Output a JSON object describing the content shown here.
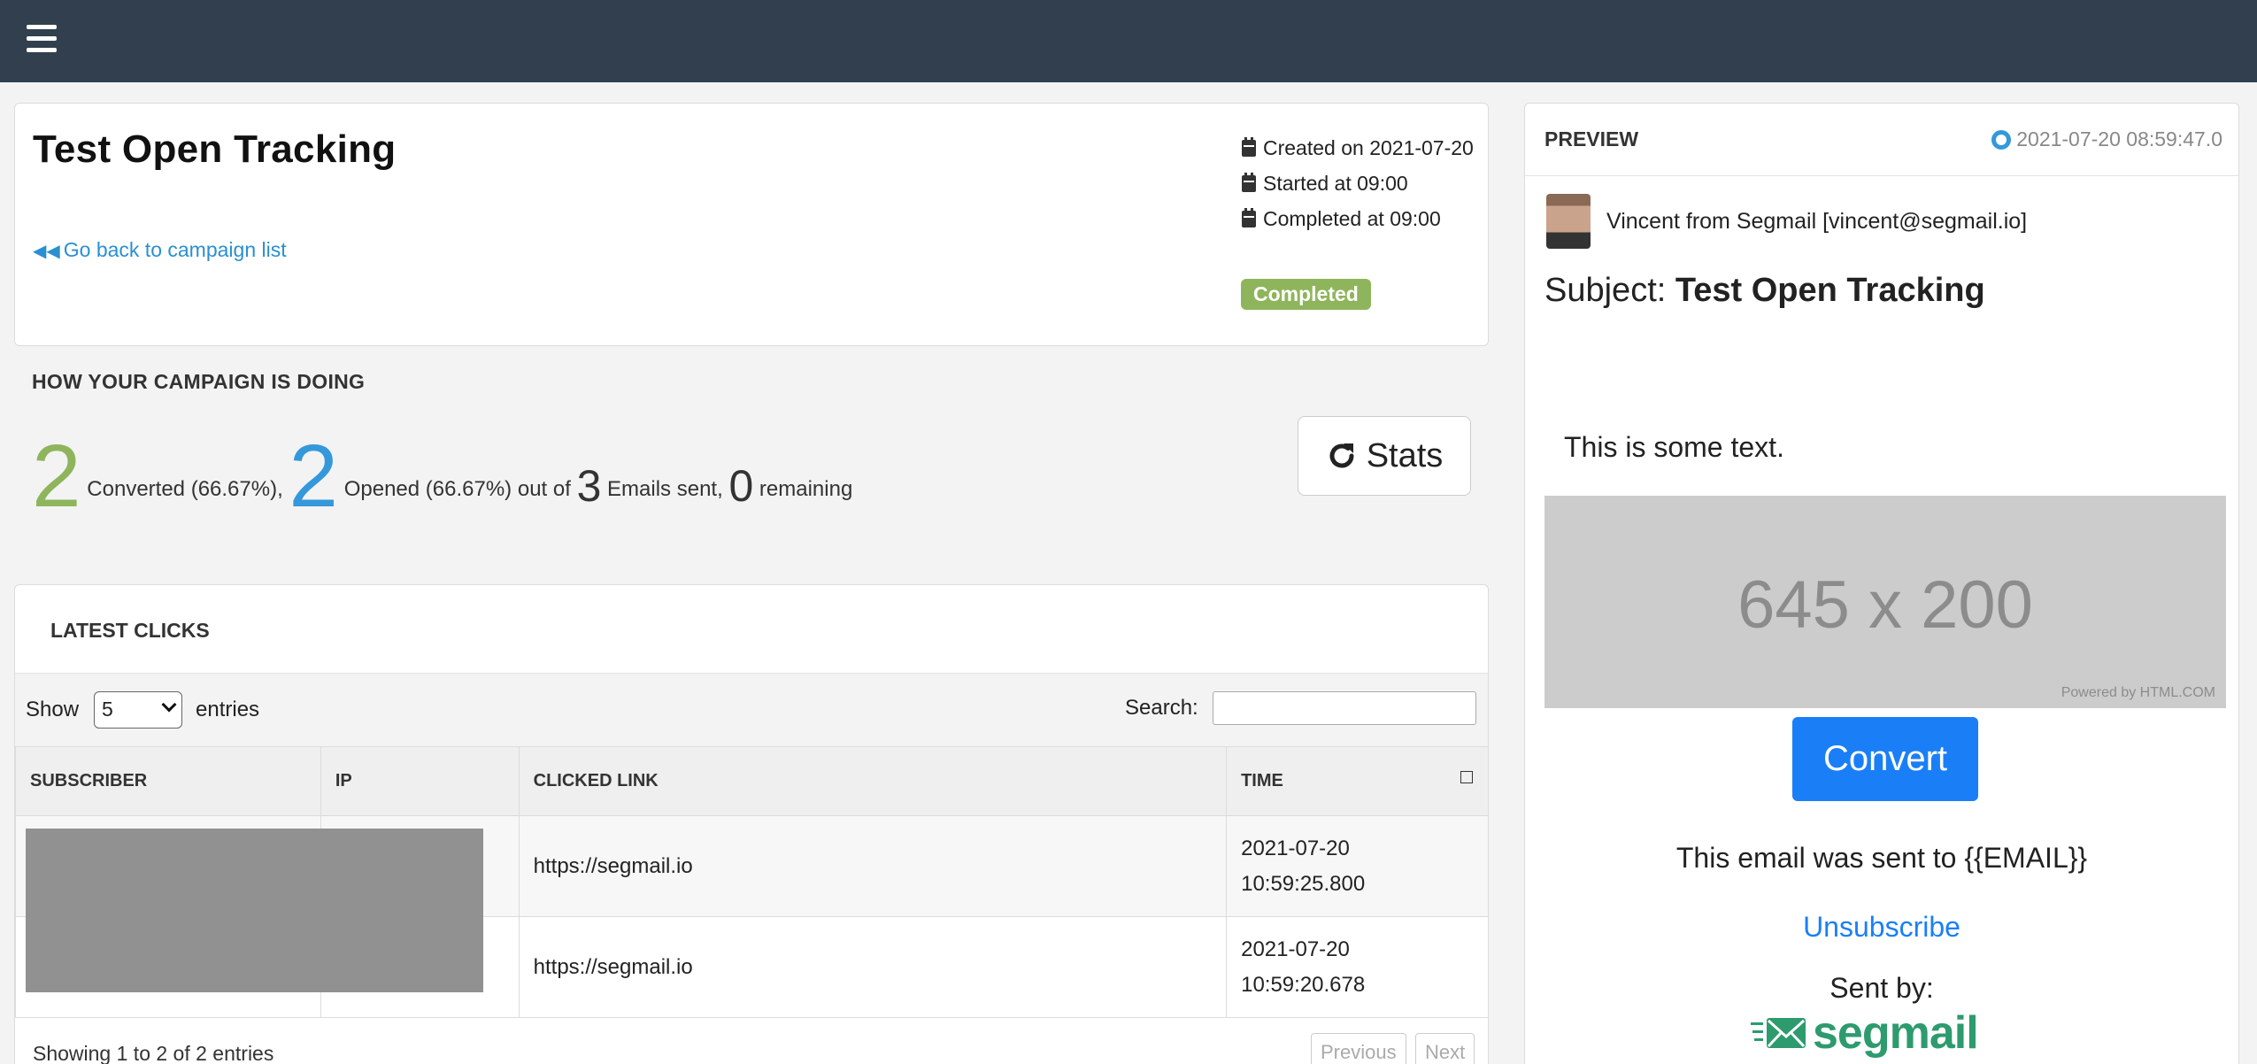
{
  "topbar": {
    "menu_icon": "hamburger-menu-icon"
  },
  "campaign": {
    "title": "Test Open Tracking",
    "back_link": "Go back to campaign list",
    "created": "Created on 2021-07-20",
    "started": "Started at 09:00",
    "completed": "Completed at 09:00",
    "status": "Completed",
    "status_color": "#8fb55c"
  },
  "stats": {
    "heading": "HOW YOUR CAMPAIGN IS DOING",
    "converted_count": "2",
    "converted_label": "Converted (66.67%),",
    "opened_count": "2",
    "opened_label": "Opened (66.67%) out of",
    "sent_count": "3",
    "sent_label": "Emails sent,",
    "remaining_count": "0",
    "remaining_label": "remaining",
    "button_label": "Stats",
    "converted_color": "#8fb55c",
    "opened_color": "#3498db"
  },
  "clicks": {
    "title": "LATEST CLICKS",
    "show_label": "Show",
    "show_value": "5",
    "entries_label": "entries",
    "search_label": "Search:",
    "columns": [
      "SUBSCRIBER",
      "IP",
      "CLICKED LINK",
      "TIME"
    ],
    "rows": [
      {
        "subscriber": "",
        "ip": "",
        "link": "https://segmail.io",
        "time_date": "2021-07-20",
        "time_clock": "10:59:25.800"
      },
      {
        "subscriber": "",
        "ip": "",
        "link": "https://segmail.io",
        "time_date": "2021-07-20",
        "time_clock": "10:59:20.678"
      }
    ],
    "showing": "Showing 1 to 2 of 2 entries",
    "prev_label": "Previous",
    "next_label": "Next"
  },
  "preview": {
    "title": "PREVIEW",
    "timestamp": "2021-07-20 08:59:47.0",
    "sender": "Vincent from Segmail [vincent@segmail.io]",
    "subject_label": "Subject:",
    "subject": "Test Open Tracking",
    "body_text": "This is some text.",
    "image_text": "645 x 200",
    "image_powered": "Powered by HTML.COM",
    "convert_label": "Convert",
    "sent_to": "This email was sent to {{EMAIL}}",
    "unsubscribe": "Unsubscribe",
    "sent_by": "Sent by:",
    "logo_text": "segmail",
    "accent_color": "#1a7ff7"
  }
}
